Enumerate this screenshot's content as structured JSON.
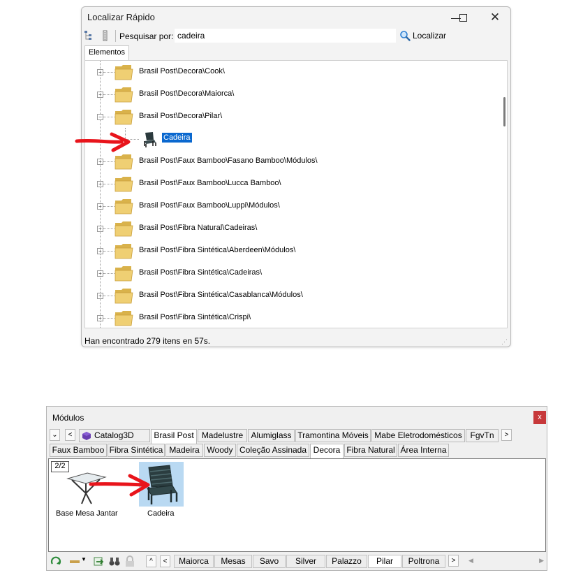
{
  "localizar": {
    "title": "Localizar Rápido",
    "search_label": "Pesquisar por:",
    "search_value": "cadeira",
    "search_button": "Localizar",
    "tab": "Elementos",
    "tree": [
      {
        "label": "Brasil Post\\Decora\\Cook\\",
        "expander": "+"
      },
      {
        "label": "Brasil Post\\Decora\\Maiorca\\",
        "expander": "+"
      },
      {
        "label": "Brasil Post\\Decora\\Pilar\\",
        "expander": "−"
      },
      {
        "label": "Cadeira",
        "selected": true,
        "icon": "chair-icon"
      },
      {
        "label": "Brasil Post\\Faux Bamboo\\Fasano Bamboo\\Módulos\\",
        "expander": "+"
      },
      {
        "label": "Brasil Post\\Faux Bamboo\\Lucca Bamboo\\",
        "expander": "+"
      },
      {
        "label": "Brasil Post\\Faux Bamboo\\Luppi\\Módulos\\",
        "expander": "+"
      },
      {
        "label": "Brasil Post\\Fibra Natural\\Cadeiras\\",
        "expander": "+"
      },
      {
        "label": "Brasil Post\\Fibra Sintética\\Aberdeen\\Módulos\\",
        "expander": "+"
      },
      {
        "label": "Brasil Post\\Fibra Sintética\\Cadeiras\\",
        "expander": "+"
      },
      {
        "label": "Brasil Post\\Fibra Sintética\\Casablanca\\Módulos\\",
        "expander": "+"
      },
      {
        "label": "Brasil Post\\Fibra Sintética\\Crispi\\",
        "expander": "+"
      }
    ],
    "status": "Han encontrado 279 itens en 57s.",
    "selection_color": "#0a68cf"
  },
  "modulos": {
    "title": "Módulos",
    "close": "x",
    "top_tabs": [
      "Catalog3D",
      "Brasil Post",
      "Madelustre",
      "Alumiglass",
      "Tramontina Móveis",
      "Mabe Eletrodomésticos",
      "FgvTn"
    ],
    "top_active": "Brasil Post",
    "sub_tabs": [
      "Faux Bamboo",
      "Fibra Sintética",
      "Madeira",
      "Woody",
      "Coleção Assinada",
      "Decora",
      "Fibra Natural",
      "Área Interna"
    ],
    "sub_active": "Decora",
    "page_indicator": "2/2",
    "items": [
      {
        "label": "Base Mesa Jantar",
        "icon": "table-base-icon"
      },
      {
        "label": "Cadeira",
        "icon": "chair-icon",
        "selected": true
      }
    ],
    "bottom_tabs": [
      "Maiorca",
      "Mesas",
      "Savo",
      "Silver",
      "Palazzo",
      "Pilar",
      "Poltrona"
    ],
    "bottom_active": "Pilar",
    "nav": {
      "left": "<",
      "right": ">",
      "up": "^",
      "down": "v"
    }
  },
  "annotation_color": "#e8141b"
}
